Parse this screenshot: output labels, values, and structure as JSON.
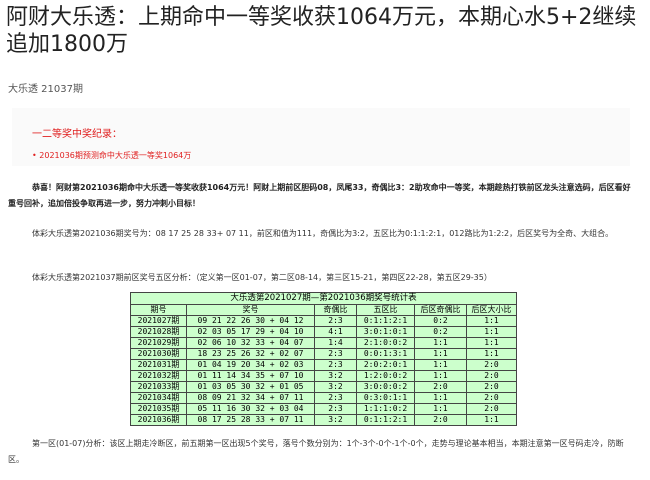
{
  "article": {
    "title": "阿财大乐透：上期命中一等奖收获1064万元，本期心水5+2继续追加1800万",
    "meta": "大乐透 21037期"
  },
  "notice": {
    "heading": "一二等奖中奖纪录：",
    "item": "• 2021036期预测命中大乐透一等奖1064万"
  },
  "paragraphs": {
    "congrats": "恭喜！阿财第2021036期命中大乐透一等奖收获1064万元！阿财上期前区胆码08，凤尾33，奇偶比3：2助攻命中一等奖，本期趁热打铁前区龙头注意选码，后区看好重号回补，追加倍投争取再进一步，努力冲刺小目标！",
    "last_draw": "体彩大乐透第2021036期奖号为：08 17 25 28 33+ 07 11，前区和值为111，奇偶比为3:2，五区比为0:1:1:2:1，012路比为1:2:2，后区奖号为全奇、大组合。",
    "analysis_intro": "体彩大乐透第2021037期前区奖号五区分析：（定义第一区01-07，第二区08-14，第三区15-21，第四区22-28，第五区29-35）",
    "zone1": "第一区(01-07)分析：该区上期走冷断区，前五期第一区出现5个奖号，落号个数分别为：1个-3个-0个-1个-0个，走势与理论基本相当，本期注意第一区号码走冷，防断区。"
  },
  "table": {
    "caption": "大乐透第2021027期—第2021036期奖号统计表",
    "headers": [
      "期号",
      "奖号",
      "奇偶比",
      "五区比",
      "后区奇偶比",
      "后区大小比"
    ],
    "rows": [
      [
        "2021027期",
        "09 21 22 26 30 + 04 12",
        "2:3",
        "0:1:1:2:1",
        "0:2",
        "1:1"
      ],
      [
        "2021028期",
        "02 03 05 17 29 + 04 10",
        "4:1",
        "3:0:1:0:1",
        "0:2",
        "1:1"
      ],
      [
        "2021029期",
        "02 06 10 32 33 + 04 07",
        "1:4",
        "2:1:0:0:2",
        "1:1",
        "1:1"
      ],
      [
        "2021030期",
        "18 23 25 26 32 + 02 07",
        "2:3",
        "0:0:1:3:1",
        "1:1",
        "1:1"
      ],
      [
        "2021031期",
        "01 04 19 20 34 + 02 03",
        "2:3",
        "2:0:2:0:1",
        "1:1",
        "2:0"
      ],
      [
        "2021032期",
        "01 11 14 34 35 + 07 10",
        "3:2",
        "1:2:0:0:2",
        "1:1",
        "2:0"
      ],
      [
        "2021033期",
        "01 03 05 30 32 + 01 05",
        "3:2",
        "3:0:0:0:2",
        "2:0",
        "2:0"
      ],
      [
        "2021034期",
        "08 09 21 32 34 + 07 11",
        "2:3",
        "0:3:0:1:1",
        "1:1",
        "2:0"
      ],
      [
        "2021035期",
        "05 11 16 30 32 + 03 04",
        "2:3",
        "1:1:1:0:2",
        "1:1",
        "2:0"
      ],
      [
        "2021036期",
        "08 17 25 28 33 + 07 11",
        "3:2",
        "0:1:1:2:1",
        "2:0",
        "1:1"
      ]
    ]
  },
  "colors": {
    "accent": "#e02020",
    "table_bg": "#ccffcc"
  }
}
